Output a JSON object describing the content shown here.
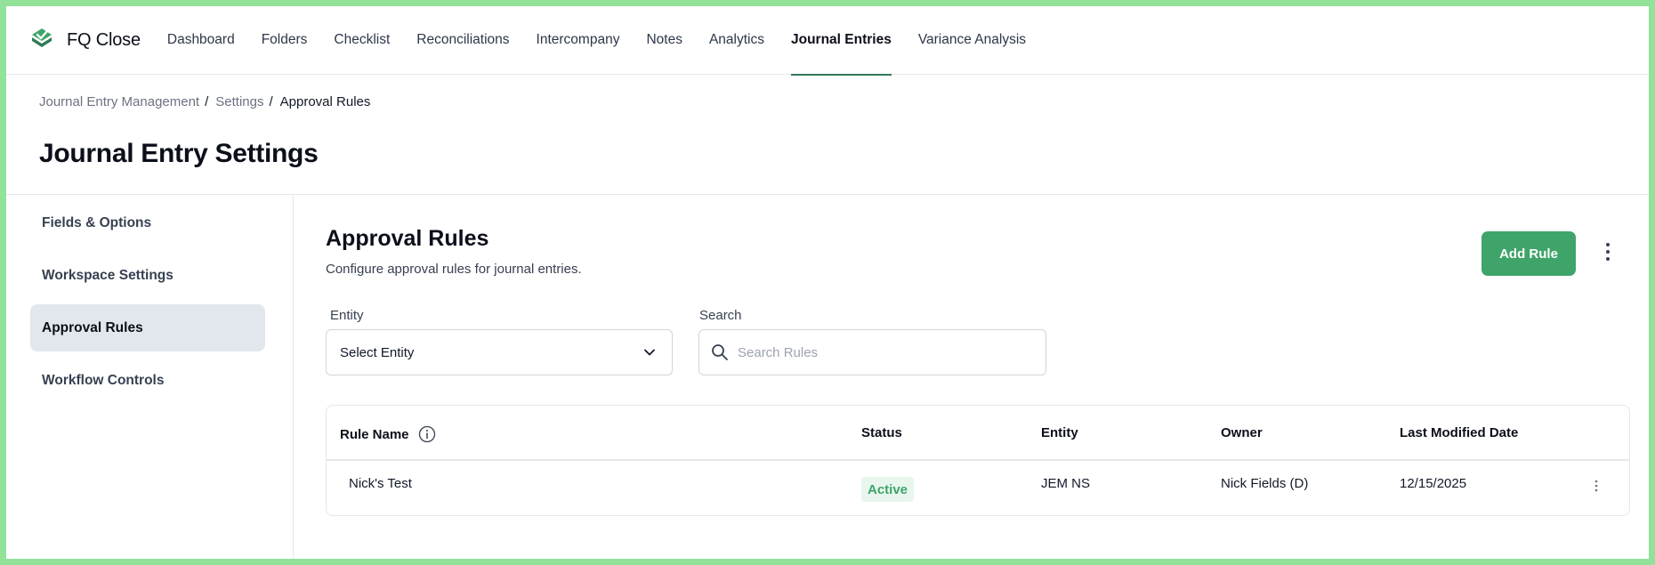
{
  "app": {
    "name": "FQ Close",
    "brand_color": "#2f7a55",
    "accent_color": "#3fa46a"
  },
  "nav": {
    "items": [
      {
        "label": "Dashboard",
        "active": false
      },
      {
        "label": "Folders",
        "active": false
      },
      {
        "label": "Checklist",
        "active": false
      },
      {
        "label": "Reconciliations",
        "active": false
      },
      {
        "label": "Intercompany",
        "active": false
      },
      {
        "label": "Notes",
        "active": false
      },
      {
        "label": "Analytics",
        "active": false
      },
      {
        "label": "Journal Entries",
        "active": true
      },
      {
        "label": "Variance Analysis",
        "active": false
      }
    ]
  },
  "breadcrumb": {
    "items": [
      "Journal Entry Management",
      "Settings"
    ],
    "separator": "/",
    "current": "Approval Rules"
  },
  "page": {
    "title": "Journal Entry Settings"
  },
  "sidebar": {
    "items": [
      {
        "label": "Fields & Options",
        "active": false
      },
      {
        "label": "Workspace Settings",
        "active": false
      },
      {
        "label": "Approval Rules",
        "active": true
      },
      {
        "label": "Workflow Controls",
        "active": false
      }
    ]
  },
  "main": {
    "title": "Approval Rules",
    "subtitle": "Configure approval rules for journal entries.",
    "add_button": "Add Rule",
    "more_icon": "vertical-ellipsis-icon"
  },
  "filters": {
    "entity_label": "Entity",
    "entity_value": "Select Entity",
    "search_label": "Search",
    "search_placeholder": "Search Rules",
    "search_value": ""
  },
  "table": {
    "columns": [
      "Rule Name",
      "Status",
      "Entity",
      "Owner",
      "Last Modified Date"
    ],
    "rows": [
      {
        "rule_name": "Nick's Test",
        "status": "Active",
        "entity": "JEM NS",
        "owner": "Nick Fields (D)",
        "last_modified": "12/15/2025"
      }
    ]
  },
  "icons": {
    "logo": "fq-logo-icon",
    "info": "info-icon",
    "chevron": "chevron-down-icon",
    "search": "search-icon",
    "row_menu": "vertical-ellipsis-icon"
  }
}
